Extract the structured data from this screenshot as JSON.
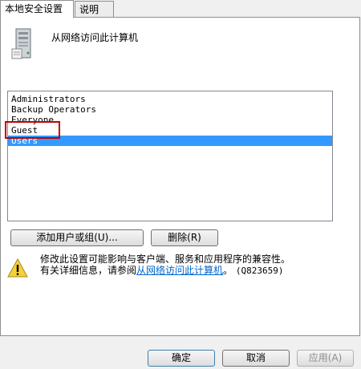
{
  "tabs": [
    {
      "label": "本地安全设置",
      "active": true
    },
    {
      "label": "说明",
      "active": false
    }
  ],
  "header": {
    "icon": "server-icon",
    "title": "从网络访问此计算机"
  },
  "list": {
    "items": [
      {
        "label": "Administrators",
        "selected": false
      },
      {
        "label": "Backup Operators",
        "selected": false
      },
      {
        "label": "Everyone",
        "selected": false
      },
      {
        "label": "Guest",
        "selected": false
      },
      {
        "label": "Users",
        "selected": true
      }
    ],
    "highlighted_item": "Guest",
    "highlight_color": "#c00000",
    "selection_color": "#3399ff"
  },
  "list_buttons": {
    "add_label": "添加用户或组(U)...",
    "remove_label": "删除(R)"
  },
  "warning": {
    "icon": "warning-icon",
    "line1": "修改此设置可能影响与客户端、服务和应用程序的兼容性。",
    "line2_prefix": "有关详细信息，请参阅",
    "link_text": "从网络访问此计算机",
    "line2_suffix": "。",
    "kb_ref": "(Q823659)"
  },
  "dialog_buttons": {
    "ok_label": "确定",
    "cancel_label": "取消",
    "apply_label": "应用(A)"
  }
}
